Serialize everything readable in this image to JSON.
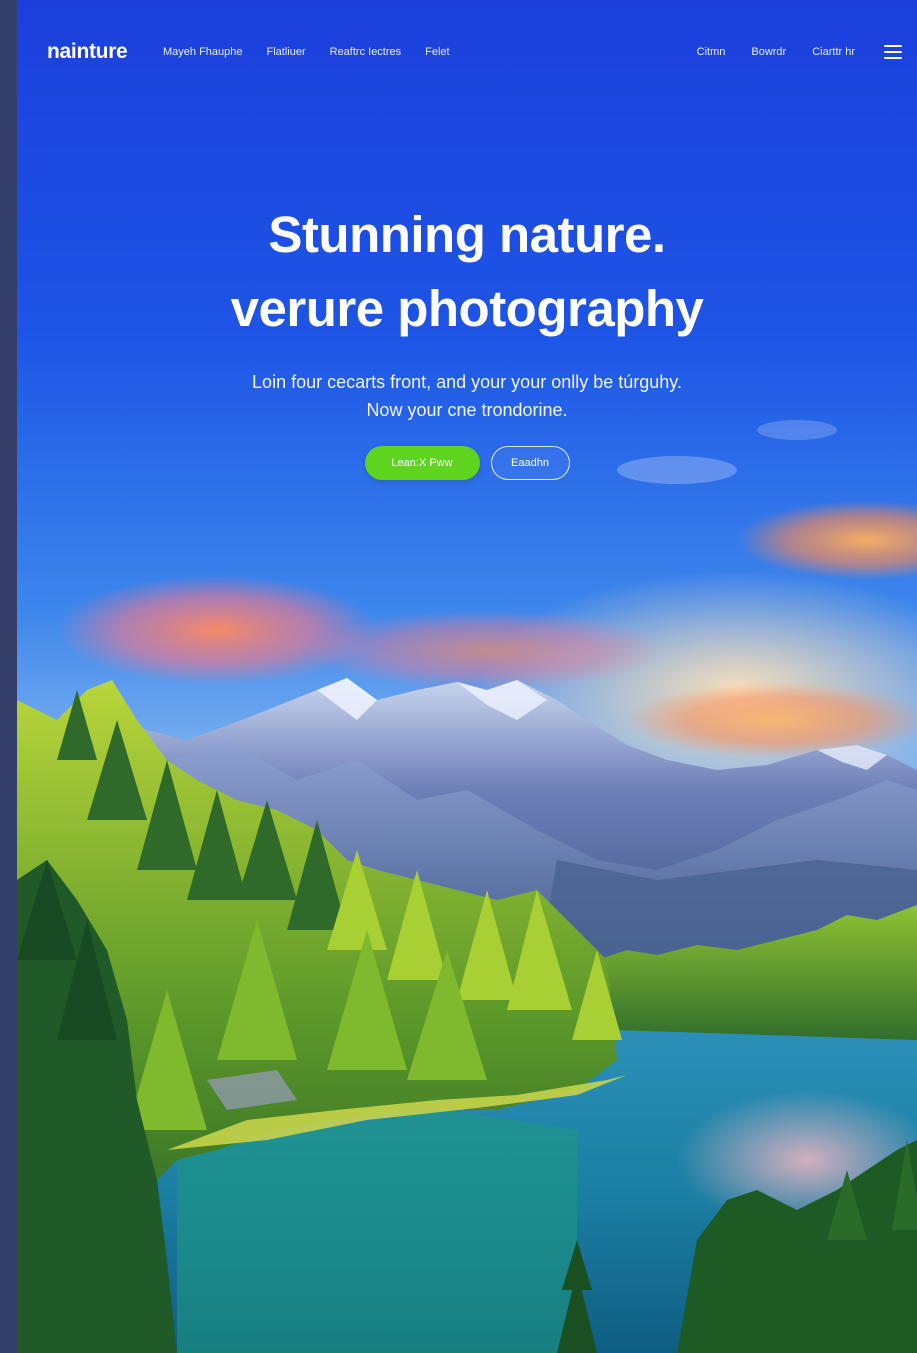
{
  "brand": {
    "logo": "nainture"
  },
  "nav": {
    "left_links": [
      "Mayeh Fhauphe",
      "Flatliuer",
      "Reaftrc Iectres",
      "Felet"
    ],
    "right_links": [
      "Citmn",
      "Bowrdr",
      "Ciarttr hr"
    ],
    "menu_icon": "hamburger-menu-icon"
  },
  "hero": {
    "title_line1": "Stunning nature.",
    "title_line2": "verure photography",
    "subtitle_line1": "Loin four cecarts front, and your your onlly be túrguhy.",
    "subtitle_line2": "Now your cne trondorine.",
    "primary_button": "Lean:X Pww",
    "secondary_button": "Eaadhn"
  },
  "colors": {
    "accent_green": "#5fd41f",
    "sky_blue": "#1f4ee0",
    "text_white": "#ffffff"
  }
}
